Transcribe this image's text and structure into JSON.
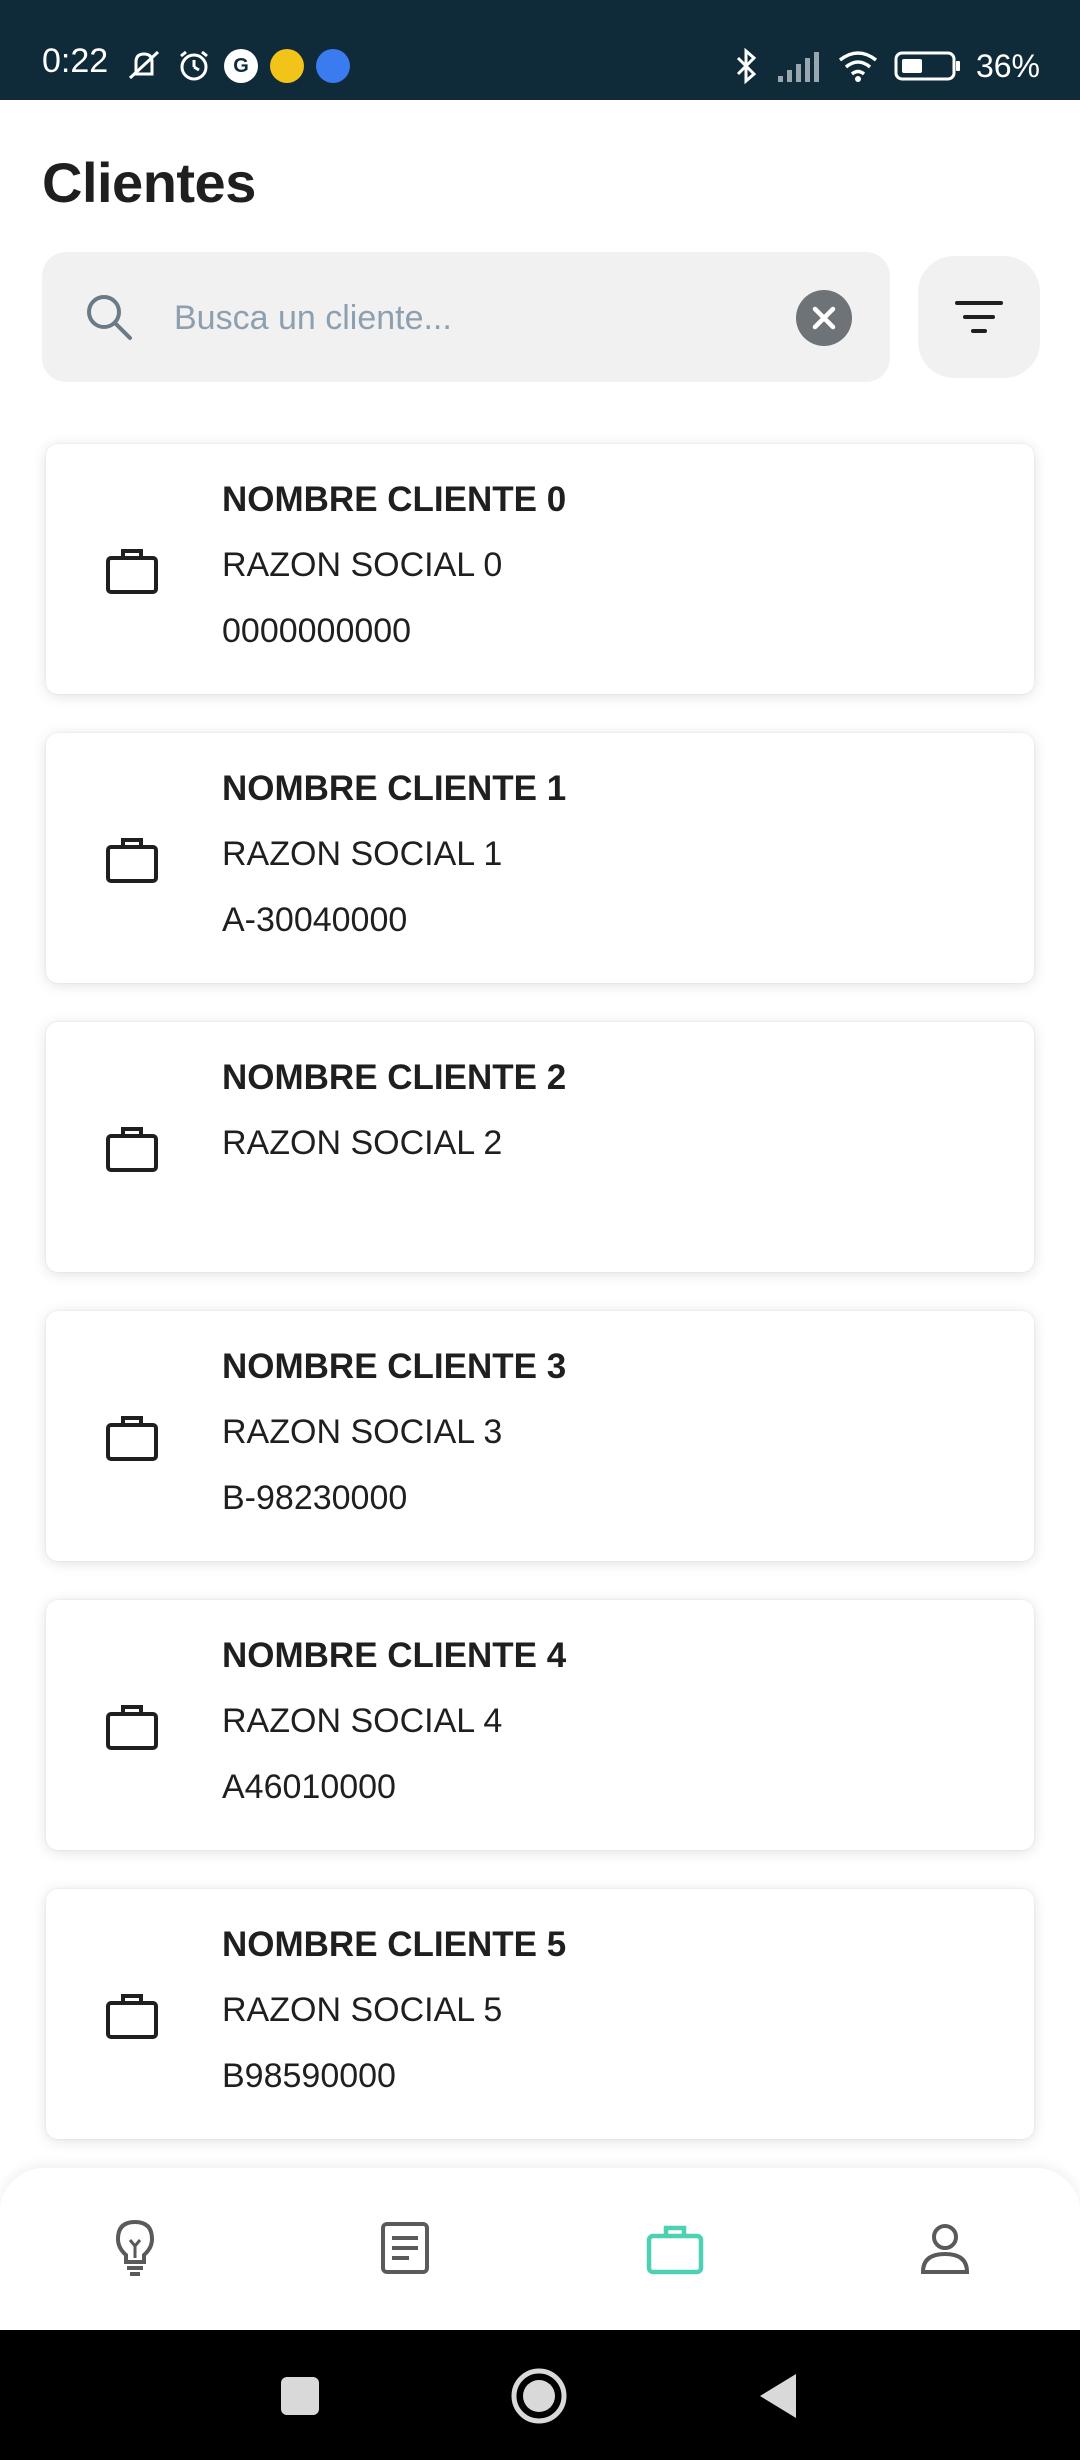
{
  "status_bar": {
    "time": "0:22",
    "battery": "36%",
    "icons_left": [
      "mute-icon",
      "alarm-icon",
      "google-icon",
      "app-icon",
      "security-icon"
    ],
    "icons_right": [
      "bluetooth-icon",
      "signal-icon",
      "wifi-icon",
      "battery-icon"
    ]
  },
  "header": {
    "title": "Clientes"
  },
  "search": {
    "placeholder": "Busca un cliente...",
    "value": ""
  },
  "clients": [
    {
      "name": "NOMBRE CLIENTE 0",
      "razon": "RAZON SOCIAL 0",
      "cif": "0000000000"
    },
    {
      "name": "NOMBRE CLIENTE 1",
      "razon": "RAZON SOCIAL 1",
      "cif": "A-30040000"
    },
    {
      "name": "NOMBRE CLIENTE 2",
      "razon": "RAZON SOCIAL 2",
      "cif": ""
    },
    {
      "name": "NOMBRE CLIENTE 3",
      "razon": "RAZON SOCIAL 3",
      "cif": "B-98230000"
    },
    {
      "name": "NOMBRE CLIENTE 4",
      "razon": "RAZON SOCIAL 4",
      "cif": "A46010000"
    },
    {
      "name": "NOMBRE CLIENTE 5",
      "razon": "RAZON SOCIAL 5",
      "cif": "B98590000"
    }
  ],
  "bottom_nav": {
    "items": [
      {
        "icon": "lightbulb-icon",
        "active": false
      },
      {
        "icon": "document-icon",
        "active": false
      },
      {
        "icon": "briefcase-icon",
        "active": true
      },
      {
        "icon": "user-icon",
        "active": false
      }
    ],
    "active_color": "#4dd0b4",
    "inactive_color": "#5a5a5a"
  },
  "colors": {
    "status_bar_bg": "#0f2a38",
    "accent": "#4dd0b4"
  }
}
